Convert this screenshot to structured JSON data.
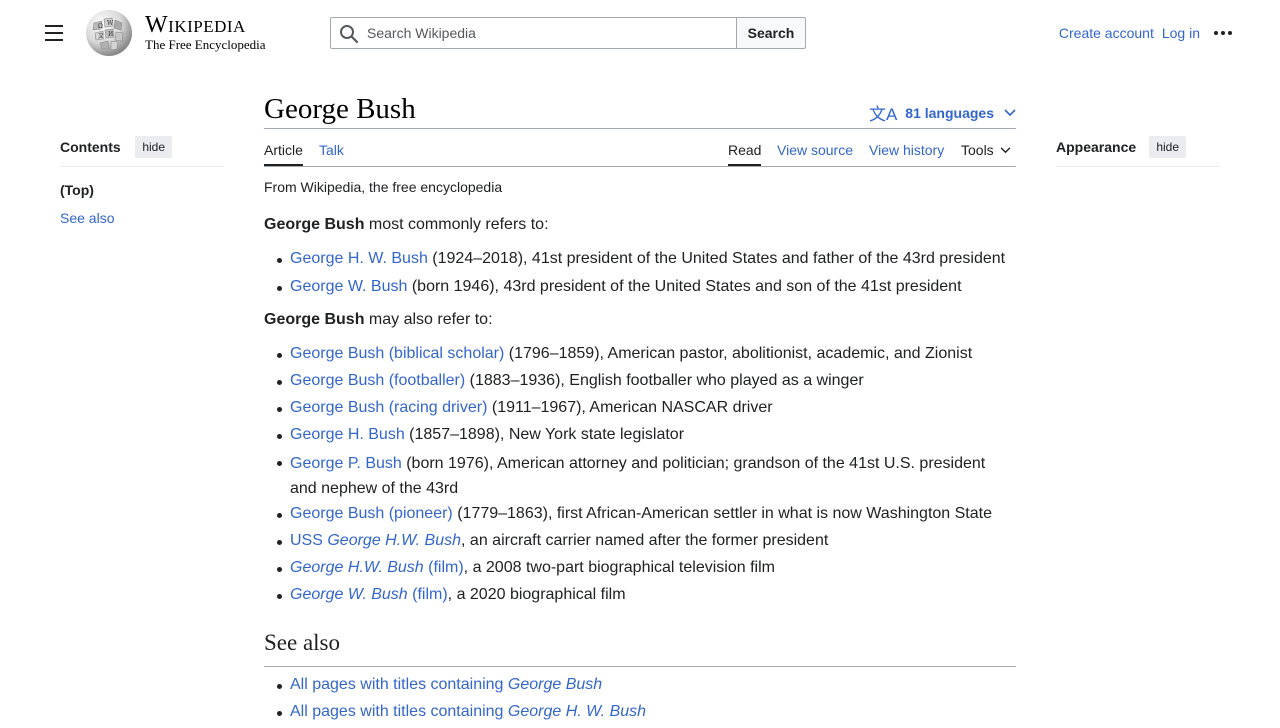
{
  "header": {
    "wordmark": "Wikipedia",
    "tagline": "The Free Encyclopedia",
    "search_placeholder": "Search Wikipedia",
    "search_button": "Search",
    "create_account": "Create account",
    "log_in": "Log in"
  },
  "toc": {
    "title": "Contents",
    "hide": "hide",
    "top": "(Top)",
    "see_also": "See also"
  },
  "appearance": {
    "title": "Appearance",
    "hide": "hide"
  },
  "article": {
    "title": "George Bush",
    "languages": "81 languages",
    "tabs": {
      "article": "Article",
      "talk": "Talk",
      "read": "Read",
      "view_source": "View source",
      "view_history": "View history",
      "tools": "Tools"
    },
    "from": "From Wikipedia, the free encyclopedia",
    "intro1_bold": "George Bush",
    "intro1_rest": " most commonly refers to:",
    "list1": [
      {
        "link": "George H. W. Bush",
        "desc": " (1924–2018), 41st president of the United States and father of the 43rd president"
      },
      {
        "link": "George W. Bush",
        "desc": " (born 1946), 43rd president of the United States and son of the 41st president"
      }
    ],
    "intro2_bold": "George Bush",
    "intro2_rest": " may also refer to:",
    "list2": [
      {
        "link": "George Bush (biblical scholar)",
        "desc": " (1796–1859), American pastor, abolitionist, academic, and Zionist"
      },
      {
        "link": "George Bush (footballer)",
        "desc": " (1883–1936), English footballer who played as a winger"
      },
      {
        "link": "George Bush (racing driver)",
        "desc": " (1911–1967), American NASCAR driver"
      },
      {
        "link": "George H. Bush",
        "desc": " (1857–1898), New York state legislator"
      },
      {
        "link": "George P. Bush",
        "desc": " (born 1976), American attorney and politician; grandson of the 41st U.S. president and nephew of the 43rd"
      },
      {
        "link": "George Bush (pioneer)",
        "desc": " (1779–1863), first African-American settler in what is now Washington State"
      },
      {
        "link_prefix": "USS ",
        "link_italic": "George H.W. Bush",
        "desc": ", an aircraft carrier named after the former president"
      },
      {
        "link_italic": "George H.W. Bush",
        "link_suffix": " (film)",
        "desc": ", a 2008 two-part biographical television film"
      },
      {
        "link_italic": "George W. Bush",
        "link_suffix": " (film)",
        "desc": ", a 2020 biographical film"
      }
    ],
    "see_also_heading": "See also",
    "list3": [
      {
        "prefix": "All pages with titles containing ",
        "italic": "George Bush"
      },
      {
        "prefix": "All pages with titles containing ",
        "italic": "George H. W. Bush"
      }
    ]
  },
  "colors": {
    "link": "#3366cc",
    "text": "#202122",
    "border": "#a2a9b1"
  },
  "icons": [
    "menu-icon",
    "wikipedia-globe-logo",
    "search-icon",
    "more-options-icon",
    "translate-icon",
    "chevron-down-icon"
  ]
}
